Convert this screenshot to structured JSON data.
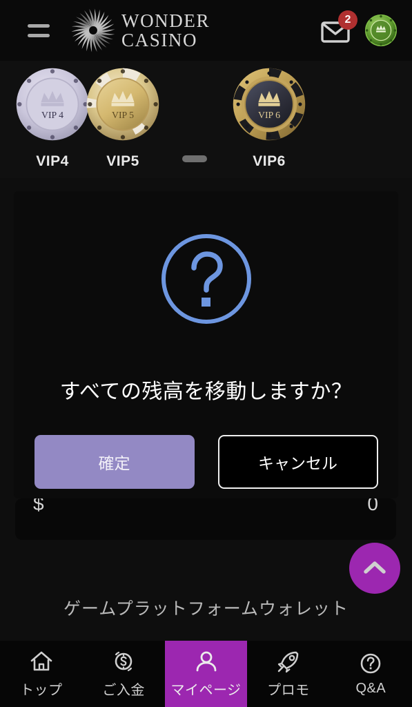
{
  "header": {
    "menu_icon": "hamburger-icon",
    "brand_line1": "WONDER",
    "brand_line2": "CASINO",
    "mail_icon": "mail-icon",
    "mail_badge_count": "2",
    "avatar_icon": "vip-chip-avatar-icon"
  },
  "vip_levels": [
    {
      "label": "VIP4",
      "chip_text": "VIP 4",
      "style": "pale-lavender",
      "chip_color": "#cdc9de"
    },
    {
      "label": "VIP5",
      "chip_text": "VIP 5",
      "style": "gold-white",
      "chip_color": "#d6b66a"
    },
    {
      "label": "VIP6",
      "chip_text": "VIP 6",
      "style": "dark-gold",
      "chip_color": "#c8a960"
    }
  ],
  "modal": {
    "icon": "question-circle-icon",
    "icon_color": "#6d96e0",
    "message": "すべての残高を移動しますか？",
    "confirm_label": "確定",
    "cancel_label": "キャンセル",
    "confirm_color": "#9389c4",
    "cancel_border_color": "#f0f0f0"
  },
  "wallet": {
    "amount_left": "$",
    "amount_right": "0",
    "caption": "ゲームプラットフォームウォレット"
  },
  "fab": {
    "icon": "chevron-up-icon",
    "color": "#9c27b0"
  },
  "bottom_nav": {
    "active_color": "#9c27b0",
    "items": [
      {
        "label": "トップ",
        "icon": "home-icon",
        "active": false
      },
      {
        "label": "ご入金",
        "icon": "coin-dollar-icon",
        "active": false
      },
      {
        "label": "マイページ",
        "icon": "person-icon",
        "active": true
      },
      {
        "label": "プロモ",
        "icon": "rocket-icon",
        "active": false
      },
      {
        "label": "Q&A",
        "icon": "question-circle-icon",
        "active": false
      }
    ]
  }
}
